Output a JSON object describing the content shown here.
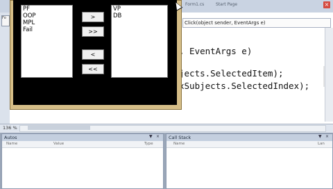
{
  "ide": {
    "tabs": [
      "Form1.cs",
      "Start Page"
    ],
    "left_tab": "Fo",
    "close_glyph": "×",
    "method_combo": "Click(object sender, EventArgs e)",
    "code_lines": [
      ", EventArgs e)",
      "jects.SelectedItem);",
      "xSubjects.SelectedIndex);"
    ],
    "zoom": "136 %"
  },
  "form": {
    "left_list": [
      "PF",
      "OOP",
      "MPL",
      "Fail"
    ],
    "right_list": [
      "VP",
      "DB"
    ],
    "buttons": {
      "add": ">",
      "add_all": ">>",
      "remove": "<",
      "remove_all": "<<"
    }
  },
  "panels": {
    "autos": {
      "title": "Autos",
      "columns": [
        "Name",
        "Value",
        "Type"
      ]
    },
    "callstack": {
      "title": "Call Stack",
      "columns": [
        "Name",
        "Lan"
      ]
    },
    "pin_glyph": "▼",
    "close_glyph": "×"
  }
}
